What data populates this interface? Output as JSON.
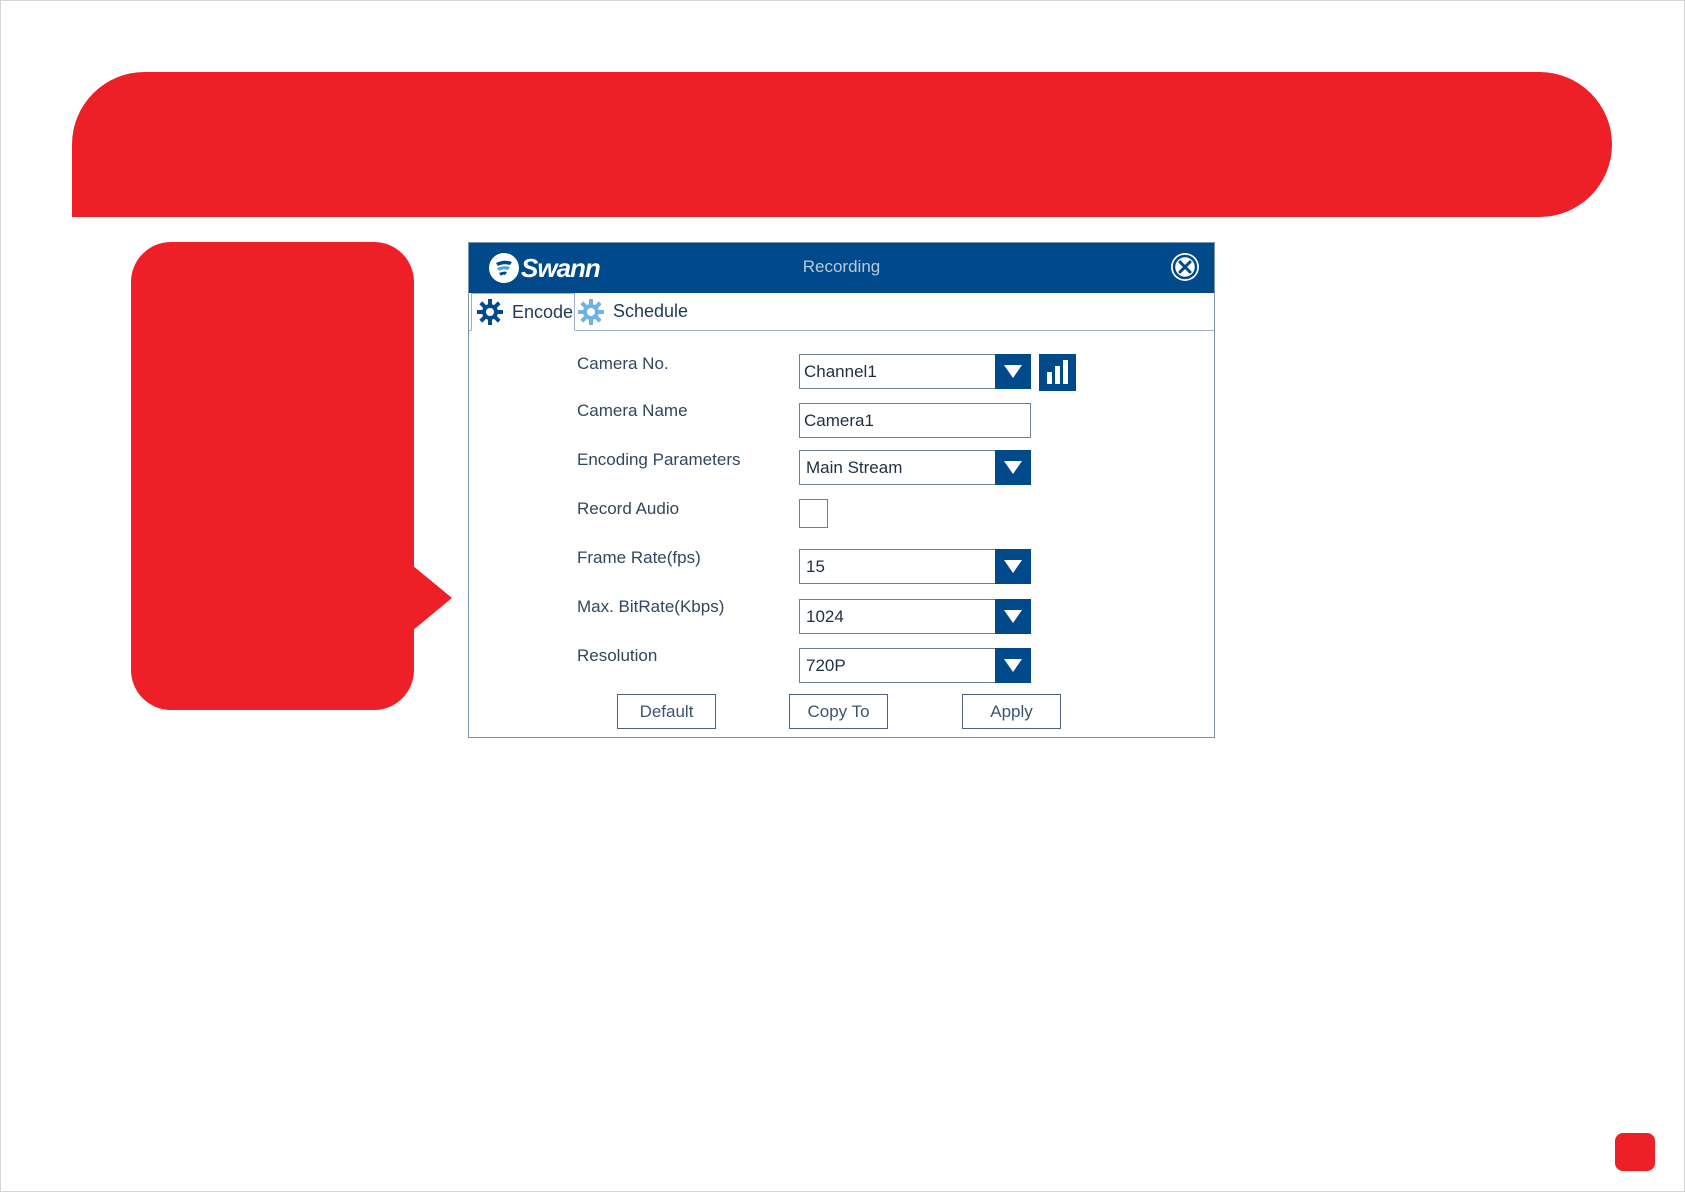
{
  "dialog": {
    "brand": "Swann",
    "title": "Recording",
    "close_icon": "close-circle-icon"
  },
  "tabs": [
    {
      "label": "Encode",
      "icon": "gear-icon",
      "active": true
    },
    {
      "label": "Schedule",
      "icon": "gear-icon",
      "active": false
    }
  ],
  "form": {
    "camera_no": {
      "label": "Camera No.",
      "value": "Channel1"
    },
    "camera_name": {
      "label": "Camera Name",
      "value": "Camera1"
    },
    "encoding_parameters": {
      "label": "Encoding Parameters",
      "value": "Main Stream"
    },
    "record_audio": {
      "label": "Record Audio",
      "checked": false
    },
    "frame_rate": {
      "label": "Frame Rate(fps)",
      "value": "15"
    },
    "max_bitrate": {
      "label": "Max. BitRate(Kbps)",
      "value": "1024"
    },
    "resolution": {
      "label": "Resolution",
      "value": "720P"
    }
  },
  "buttons": {
    "default": "Default",
    "copy_to": "Copy To",
    "apply": "Apply"
  },
  "colors": {
    "accent_red": "#ee1f26",
    "titlebar_blue": "#004a8c"
  }
}
